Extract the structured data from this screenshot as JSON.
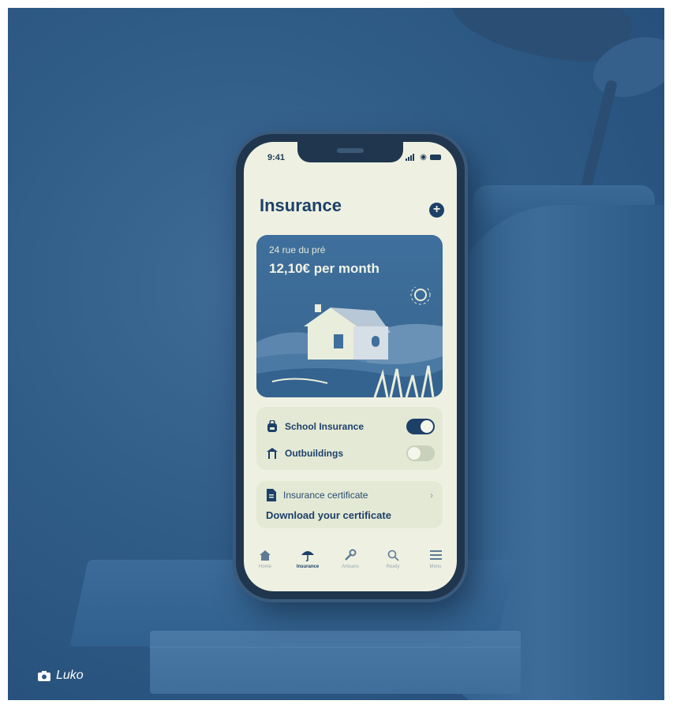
{
  "phone": {
    "status_bar": {
      "time": "9:41"
    },
    "header": {
      "title": "Insurance",
      "add_icon": "plus-circle-icon"
    },
    "policy_card": {
      "address": "24 rue du pré",
      "price": "12,10€ per month",
      "illustration": "house-landscape"
    },
    "coverage_options": [
      {
        "label": "School Insurance",
        "icon": "backpack-icon",
        "enabled": true
      },
      {
        "label": "Outbuildings",
        "icon": "shed-icon",
        "enabled": false
      }
    ],
    "certificate": {
      "label": "Insurance certificate",
      "action": "Download your certificate",
      "icon": "document-icon"
    },
    "tab_bar": [
      {
        "label": "Home",
        "icon": "home-icon",
        "active": false
      },
      {
        "label": "Insurance",
        "icon": "umbrella-icon",
        "active": true
      },
      {
        "label": "Artisans",
        "icon": "wrench-icon",
        "active": false
      },
      {
        "label": "Realty",
        "icon": "search-icon",
        "active": false
      },
      {
        "label": "Menu",
        "icon": "menu-icon",
        "active": false
      }
    ]
  },
  "credit": {
    "text": "Luko",
    "icon": "camera-icon"
  },
  "colors": {
    "accent": "#1d4069",
    "screen_bg": "#eef1e1",
    "card_bg": "#3f6f9c",
    "photo_tint": "#2f5c87"
  }
}
